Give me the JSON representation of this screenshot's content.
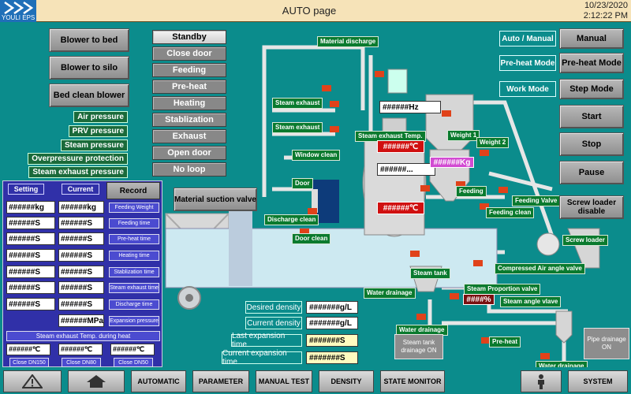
{
  "header": {
    "logo_text": "YOULI EPS",
    "title": "AUTO page",
    "date": "10/23/2020",
    "time": "2:12:22 PM"
  },
  "left_buttons": {
    "blower_bed": "Blower to bed",
    "blower_silo": "Blower to silo",
    "bed_clean": "Bed clean blower"
  },
  "status_labels": [
    "Air pressure",
    "PRV pressure",
    "Steam pressure",
    "Overpressure protection",
    "Steam exhaust pressure"
  ],
  "steps": [
    "Standby",
    "Close door",
    "Feeding",
    "Pre-heat",
    "Heating",
    "Stablization",
    "Exhaust",
    "Open door",
    "No loop"
  ],
  "material_suction": "Material suction valve",
  "panel": {
    "setting": "Setting",
    "current": "Current",
    "record": "Record",
    "setting_values": [
      "######kg",
      "######S",
      "######S",
      "######S",
      "######S",
      "######S",
      "######S"
    ],
    "current_values": [
      "######kg",
      "######S",
      "######S",
      "######S",
      "######S",
      "######S",
      "######S"
    ],
    "mpa_value": "######MPa",
    "minis": [
      "Feeding Weight",
      "Feeding time",
      "Pre-heat time",
      "Heating time",
      "Stablization time",
      "Steam exhaust time",
      "Discharge time",
      "Expansion pressure"
    ],
    "steam_heat_label": "Steam exhaust Temp. during heat",
    "temps": [
      "######℃",
      "######℃",
      "######℃"
    ],
    "closes": [
      "Close DN150",
      "Close DN80",
      "Close DN50"
    ]
  },
  "density": {
    "labels": [
      "Desired density",
      "Current density",
      "Last expansion time",
      "Current expansion time"
    ],
    "values": [
      "#######g/L",
      "#######g/L",
      "#######S",
      "#######S"
    ]
  },
  "process_labels": {
    "material_discharge": "Material discharge",
    "steam_exhaust_1": "Steam exhaust",
    "steam_exhaust_2": "Steam exhaust",
    "steam_exhaust_temp": "Steam exhaust Temp.",
    "window_clean": "Window clean",
    "door": "Door",
    "discharge_clean": "Discharge clean",
    "door_clean": "Door clean",
    "weight_1": "Weight 1",
    "weight_2": "Weight 2",
    "feeding": "Feeding",
    "feeding_valve": "Feeding Valve",
    "feeding_clean": "Feeding clean",
    "screw_loader": "Screw loader",
    "compressed_air": "Compressed Air angle valve",
    "steam_tank": "Steam tank",
    "steam_proportion": "Steam Proportion valve",
    "steam_angle": "Steam angle vlave",
    "water_drainage_1": "Water drainage",
    "water_drainage_2": "Water drainage",
    "water_drainage_3": "Water drainage",
    "pre_heat": "Pre-heat"
  },
  "readouts": {
    "hz": "######Hz",
    "temp1": "######℃",
    "temp2": "######℃",
    "mid": "######...",
    "kg": "######Kg",
    "pct": "####%",
    "steam_tank_drainage": "Steam tank drainage ON",
    "pipe_drainage": "Pipe drainage ON"
  },
  "right": {
    "auto_manual": "Auto / Manual",
    "manual": "Manual",
    "preheat_mode": "Pre-heat Mode",
    "preheat_mode_btn": "Pre-heat Mode",
    "work_mode": "Work Mode",
    "step_mode": "Step Mode",
    "start": "Start",
    "stop": "Stop",
    "pause": "Pause",
    "screw_disable": "Screw loader disable"
  },
  "nav": {
    "automatic": "AUTOMATIC",
    "parameter": "PARAMETER",
    "manual_test": "MANUAL TEST",
    "density": "DENSITY",
    "state_monitor": "STATE MONITOR",
    "system": "SYSTEM"
  },
  "colors": {
    "background": "#0b8c8c",
    "header": "#f6e3b8",
    "label_green": "#0a7a2e",
    "panel_blue": "#3030a8",
    "alarm_red": "#d01010",
    "highlight_magenta": "#d24bd2"
  }
}
